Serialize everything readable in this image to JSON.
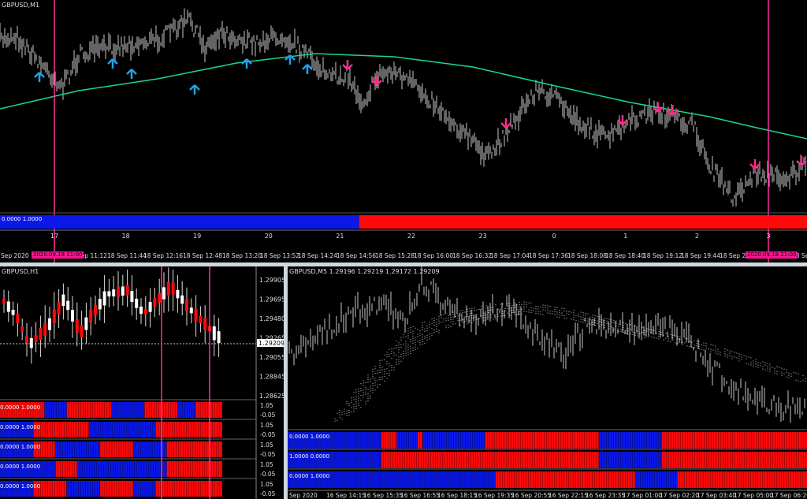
{
  "colors": {
    "background": "#000000",
    "candle": "#c8c8c8",
    "ma": "#17d98c",
    "arrow_up": "#1fa2e8",
    "arrow_down": "#ff2a8a",
    "vline": "#ff2da0",
    "blue": "#0a18e8",
    "red": "#ff0a0a",
    "separator": "#cfd8dc"
  },
  "top_chart": {
    "title": "GBPUSD,M1",
    "indicator_label": "0.0000 1.0000",
    "indicator_split_fraction": 0.445,
    "hour_labels": [
      "17",
      "18",
      "19",
      "20",
      "21",
      "22",
      "23",
      "0",
      "1",
      "2",
      "3"
    ],
    "time_labels": [
      "Sep 2020",
      "2020.09.18 11:00",
      "18 Sep 11:12",
      "18 Sep 11:44",
      "18 Sep 12:16",
      "18 Sep 12:48",
      "18 Sep 13:20",
      "18 Sep 13:52",
      "18 Sep 14:24",
      "18 Sep 14:56",
      "18 Sep 15:28",
      "18 Sep 16:00",
      "18 Sep 16:32",
      "18 Sep 17:04",
      "18 Sep 17:36",
      "18 Sep 18:08",
      "18 Sep 18:40",
      "18 Sep 19:12",
      "18 Sep 19:44",
      "18 Sep 20:1",
      "2020.09.18 21:00",
      "18 Sep"
    ]
  },
  "left_chart": {
    "title": "GBPUSD,H1",
    "price_labels": [
      "1.29905",
      "1.29695",
      "1.29480",
      "1.29265",
      "1.29055",
      "1.28845",
      "1.28625"
    ],
    "current_price": "1.29209",
    "sub_panels": [
      {
        "label": "0.0000 1.0000",
        "scale_top": "1.05",
        "scale_bottom": "-0.05"
      },
      {
        "label": "0.0000 1.0000",
        "scale_top": "1.05",
        "scale_bottom": "-0.05"
      },
      {
        "label": "0.0000 1.0000",
        "scale_top": "1.05",
        "scale_bottom": "-0.05"
      },
      {
        "label": "0.0000 1.0000",
        "scale_top": "1.05",
        "scale_bottom": "-0.05"
      },
      {
        "label": "0.0000 1.0000",
        "scale_top": "1.05",
        "scale_bottom": "-0.05"
      }
    ]
  },
  "right_chart": {
    "title": "GBPUSD,M5  1.29196 1.29219 1.29172 1.29209",
    "sub_panels": [
      {
        "label": "0.0000 1.0000"
      },
      {
        "label": "1.0000 0.0000"
      },
      {
        "label": "0.0000 1.0000"
      }
    ],
    "time_labels": [
      "Sep 2020",
      "16 Sep 14:15",
      "16 Sep 15:35",
      "16 Sep 16:55",
      "16 Sep 18:15",
      "16 Sep 19:35",
      "16 Sep 20:55",
      "16 Sep 22:15",
      "16 Sep 23:35",
      "17 Sep 01:00",
      "17 Sep 02:20",
      "17 Sep 03:40",
      "17 Sep 05:00",
      "17 Sep 06:20"
    ]
  }
}
